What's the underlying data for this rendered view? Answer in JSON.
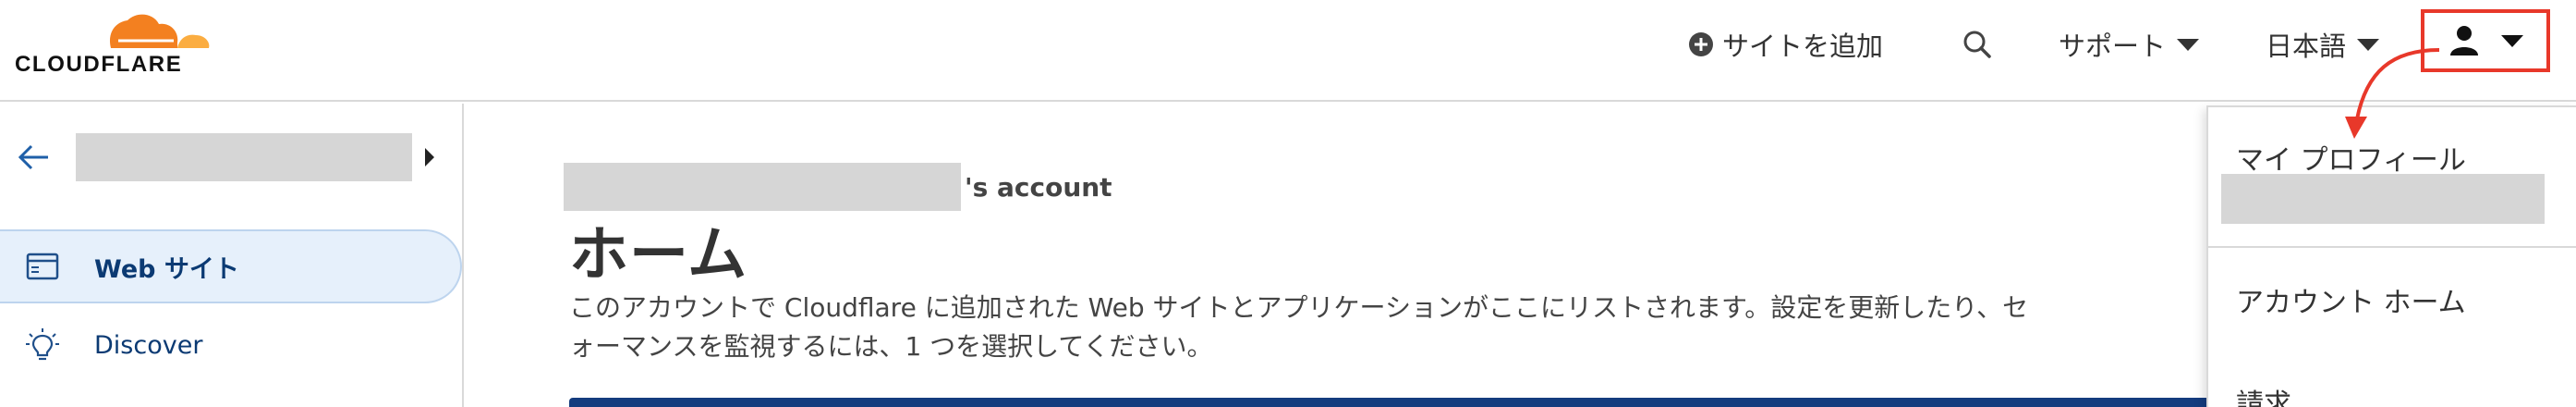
{
  "brand": {
    "logo_text": "CLOUDFLARE",
    "accent_color": "#f38020",
    "accent_light": "#fbad41"
  },
  "header": {
    "add_site_label": "サイトを追加",
    "add_site_icon": "plus-circle-icon",
    "search_icon": "search-icon",
    "support_label": "サポート",
    "language_label": "日本語",
    "user_icon": "user-icon",
    "highlight_color": "#e8382a"
  },
  "sidebar": {
    "back_icon": "arrow-left-icon",
    "items": [
      {
        "label": "Web サイト",
        "icon": "browser-window-icon",
        "active": true
      },
      {
        "label": "Discover",
        "icon": "lightbulb-icon",
        "active": false
      }
    ]
  },
  "main": {
    "account_suffix": "'s account",
    "title": "ホーム",
    "description": "このアカウントで Cloudflare に追加された Web サイトとアプリケーションがここにリストされます。設定を更新したり、セ\nォーマンスを監視するには、1 つを選択してください。"
  },
  "user_menu": {
    "my_profile": "マイ プロフィール",
    "account_home": "アカウント ホーム",
    "billing": "請求"
  }
}
